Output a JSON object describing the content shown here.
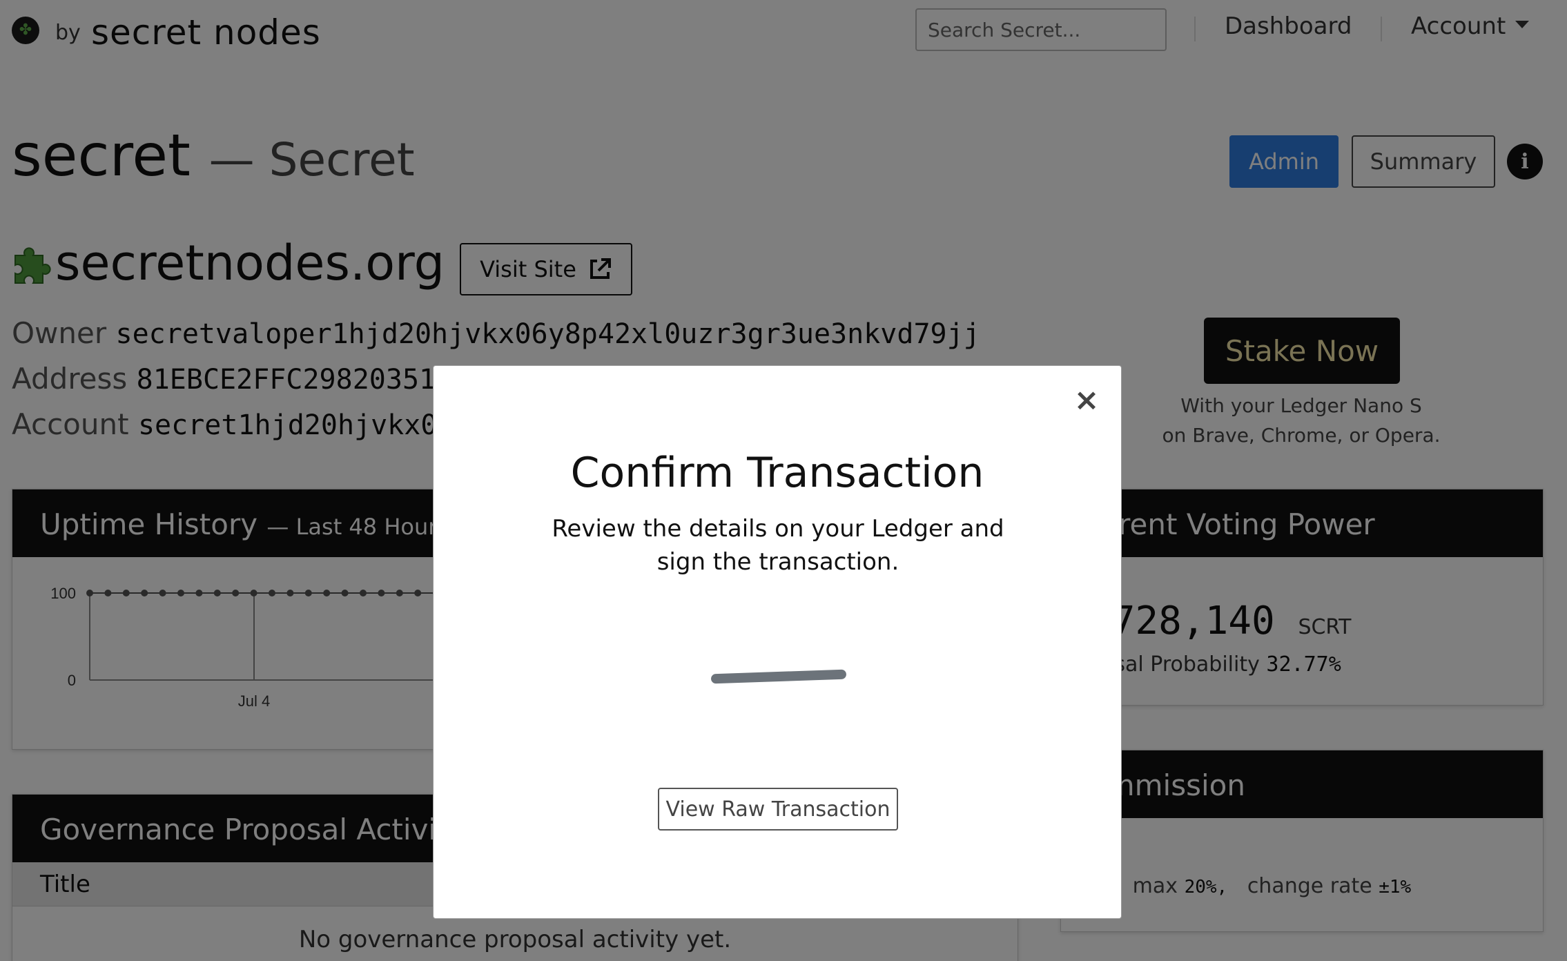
{
  "navbar": {
    "brand_by": "by",
    "brand_name": "secret nodes",
    "search_placeholder": "Search Secret...",
    "dashboard": "Dashboard",
    "account": "Account"
  },
  "header": {
    "title": "secret",
    "subtitle": "— Secret",
    "admin_label": "Admin",
    "summary_label": "Summary",
    "info_icon": "info-icon"
  },
  "validator": {
    "name": "secretnodes.org",
    "visit_label": "Visit Site",
    "owner_label": "Owner",
    "owner_value": "secretvaloper1hjd20hjvkx06y8p42xl0uzr3gr3ue3nkvd79jj",
    "address_label": "Address",
    "address_value": "81EBCE2FFC29820351",
    "account_label": "Account",
    "account_value": "secret1hjd20hjvkx0"
  },
  "stake": {
    "button_label": "Stake Now",
    "note_line1": "With your Ledger Nano S",
    "note_line2": "on Brave, Chrome, or Opera."
  },
  "uptime": {
    "title": "Uptime History",
    "subtitle": "— Last 48 Hour",
    "chart_data": {
      "type": "line",
      "ylim": [
        0,
        100
      ],
      "y_ticks": [
        "100",
        "0"
      ],
      "x_ticks": [
        "Jul 4"
      ],
      "values": [
        100,
        100,
        100,
        100,
        100,
        100,
        100,
        100,
        100,
        100,
        100,
        100,
        100,
        100,
        100,
        100,
        100,
        100,
        100,
        100
      ]
    }
  },
  "voting_power": {
    "title": "urrent Voting Power",
    "value": ",728,140",
    "unit": "SCRT",
    "prob_label": "posal Probability",
    "prob_value": "32.77%"
  },
  "commission": {
    "title": "ommission",
    "value": "%",
    "max_label": "max",
    "max_value": "20%,",
    "change_label": "change rate",
    "change_value": "±1%"
  },
  "governance": {
    "title": "Governance Proposal Activi",
    "column_title": "Title",
    "empty_message": "No governance proposal activity yet."
  },
  "modal": {
    "title": "Confirm Transaction",
    "message": "Review the details on your Ledger and sign the transaction.",
    "raw_button": "View Raw Transaction",
    "close_symbol": "×"
  },
  "colors": {
    "primary": "#2f7de1",
    "dark": "#111111",
    "stake_text": "#f5e6a8",
    "brand_green": "#5fae4a"
  }
}
